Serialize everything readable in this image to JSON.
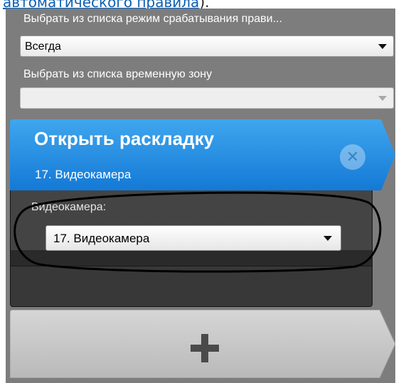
{
  "caption": {
    "link_text": "автоматического правила",
    "tail_text": ")."
  },
  "rule_mode": {
    "label": "Выбрать из списка режим срабатывания прави...",
    "selected": "Всегда"
  },
  "time_zone": {
    "label": "Выбрать из списка временную зону",
    "selected": ""
  },
  "action_card": {
    "title": "Открыть раскладку",
    "subtitle": "17. Видеокамера",
    "camera_label": "Видеокамера:",
    "camera_selected": "17. Видеокамера"
  },
  "colors": {
    "panel_bg": "#7d7d7d",
    "header_blue": "#1c8ae3",
    "caption_link": "#0a5fb4"
  },
  "icons": {
    "remove": "close-icon",
    "add": "plus-icon",
    "dropdown": "chevron-down-icon"
  }
}
